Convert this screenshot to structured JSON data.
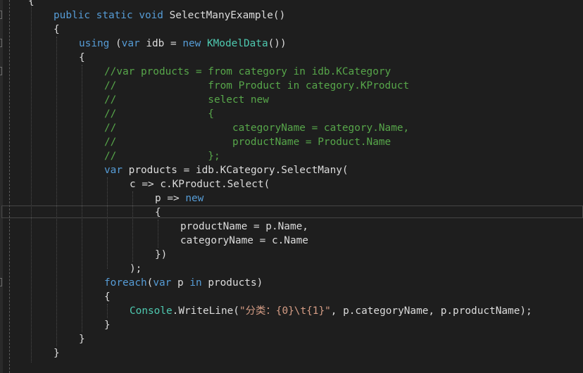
{
  "lines": [
    [
      {
        "t": "tx",
        "s": "{"
      }
    ],
    [
      {
        "t": "kw",
        "s": "public"
      },
      {
        "t": "tx",
        "s": " "
      },
      {
        "t": "kw",
        "s": "static"
      },
      {
        "t": "tx",
        "s": " "
      },
      {
        "t": "kw",
        "s": "void"
      },
      {
        "t": "tx",
        "s": " SelectManyExample()"
      }
    ],
    [
      {
        "t": "tx",
        "s": "{"
      }
    ],
    [
      {
        "t": "kw",
        "s": "using"
      },
      {
        "t": "tx",
        "s": " ("
      },
      {
        "t": "kw",
        "s": "var"
      },
      {
        "t": "tx",
        "s": " idb = "
      },
      {
        "t": "kw",
        "s": "new"
      },
      {
        "t": "tx",
        "s": " "
      },
      {
        "t": "ty",
        "s": "KModelData"
      },
      {
        "t": "tx",
        "s": "())"
      }
    ],
    [
      {
        "t": "tx",
        "s": "{"
      }
    ],
    [
      {
        "t": "cm",
        "s": "//var products = from category in idb.KCategory"
      }
    ],
    [
      {
        "t": "cm",
        "s": "//               from Product in category.KProduct"
      }
    ],
    [
      {
        "t": "cm",
        "s": "//               select new"
      }
    ],
    [
      {
        "t": "cm",
        "s": "//               {"
      }
    ],
    [
      {
        "t": "cm",
        "s": "//                   categoryName = category.Name,"
      }
    ],
    [
      {
        "t": "cm",
        "s": "//                   productName = Product.Name"
      }
    ],
    [
      {
        "t": "cm",
        "s": "//               };"
      }
    ],
    [
      {
        "t": "kw",
        "s": "var"
      },
      {
        "t": "tx",
        "s": " products = idb.KCategory.SelectMany("
      }
    ],
    [
      {
        "t": "tx",
        "s": "c => c.KProduct.Select("
      }
    ],
    [
      {
        "t": "tx",
        "s": "p => "
      },
      {
        "t": "kw",
        "s": "new"
      }
    ],
    [
      {
        "t": "tx",
        "s": "{"
      }
    ],
    [
      {
        "t": "tx",
        "s": "productName = p.Name,"
      }
    ],
    [
      {
        "t": "tx",
        "s": "categoryName = c.Name"
      }
    ],
    [
      {
        "t": "tx",
        "s": "})"
      }
    ],
    [
      {
        "t": "tx",
        "s": ");"
      }
    ],
    [
      {
        "t": "kw",
        "s": "foreach"
      },
      {
        "t": "tx",
        "s": "("
      },
      {
        "t": "kw",
        "s": "var"
      },
      {
        "t": "tx",
        "s": " p "
      },
      {
        "t": "kw",
        "s": "in"
      },
      {
        "t": "tx",
        "s": " products)"
      }
    ],
    [
      {
        "t": "tx",
        "s": "{"
      }
    ],
    [
      {
        "t": "ty",
        "s": "Console"
      },
      {
        "t": "tx",
        "s": "."
      },
      {
        "t": "tx",
        "s": "WriteLine("
      },
      {
        "t": "st",
        "s": "\"分类：{0}\\t{1}\""
      },
      {
        "t": "tx",
        "s": ", p.categoryName, p.productName);"
      }
    ],
    [
      {
        "t": "tx",
        "s": "}"
      }
    ],
    [
      {
        "t": "tx",
        "s": "}"
      }
    ],
    [
      {
        "t": "tx",
        "s": "}"
      }
    ]
  ]
}
